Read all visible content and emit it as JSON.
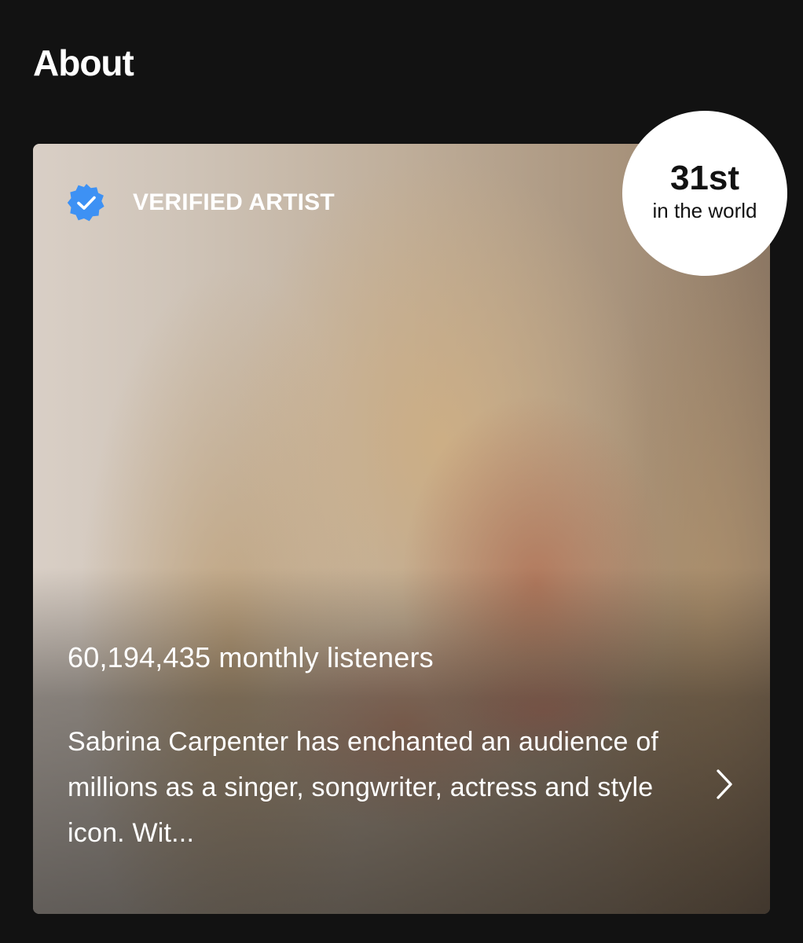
{
  "section": {
    "title": "About"
  },
  "card": {
    "verified_label": "VERIFIED ARTIST",
    "monthly_listeners": "60,194,435 monthly listeners",
    "bio": "Sabrina Carpenter has enchanted an audience of millions as a singer, songwriter, actress and style icon. Wit...",
    "badge_icon": "verified-check-icon",
    "chevron_icon": "chevron-right-icon"
  },
  "rank": {
    "number": "31st",
    "caption": "in the world"
  },
  "colors": {
    "background": "#121212",
    "verified_blue": "#3d91f4",
    "text": "#ffffff",
    "rank_badge_bg": "#ffffff"
  }
}
